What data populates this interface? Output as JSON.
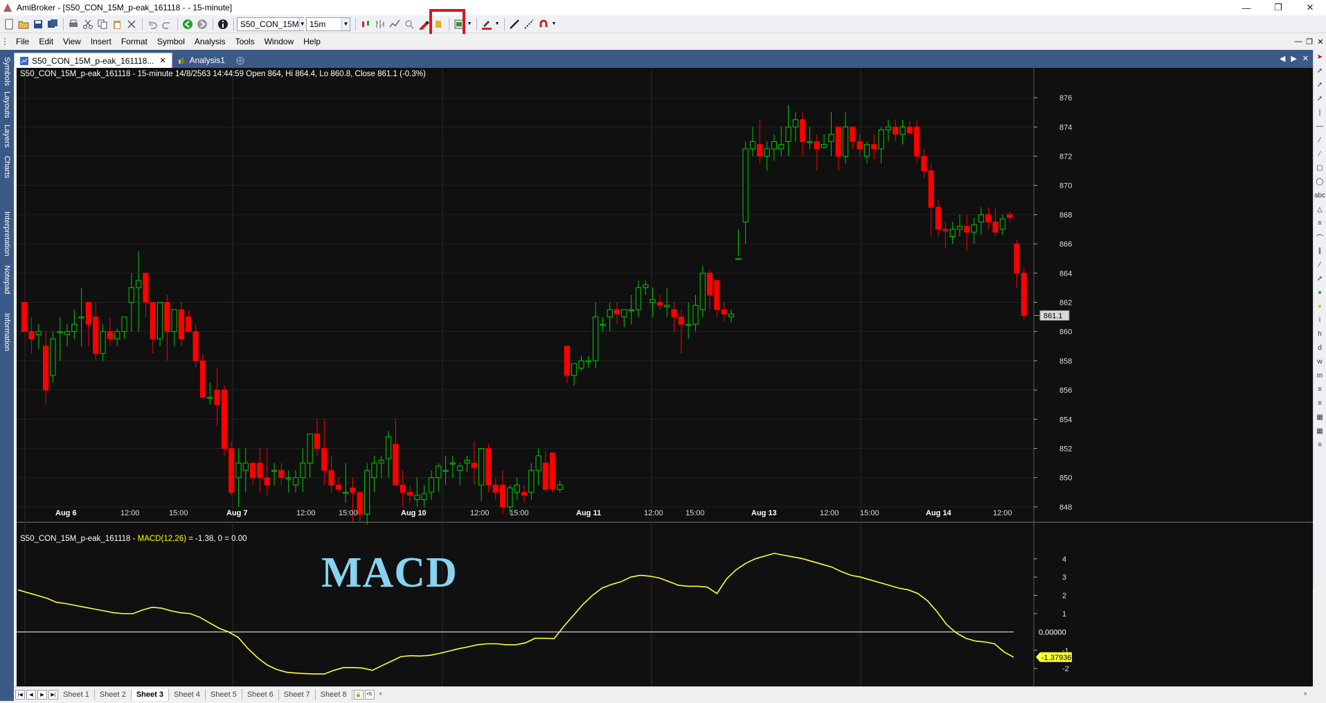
{
  "window": {
    "title": "AmiBroker - [S50_CON_15M_p-eak_161118 -  - 15-minute]"
  },
  "toolbar": {
    "symbol_combo": "S50_CON_15M",
    "interval_combo": "15m"
  },
  "menu": [
    "File",
    "Edit",
    "View",
    "Insert",
    "Format",
    "Symbol",
    "Analysis",
    "Tools",
    "Window",
    "Help"
  ],
  "side_tabs": [
    "Symbols",
    "Layouts",
    "Layers",
    "Charts",
    "Interpretation",
    "Notepad",
    "Information"
  ],
  "doc_tabs": [
    {
      "label": "S50_CON_15M_p-eak_161118..."
    },
    {
      "label": "Analysis1"
    }
  ],
  "price_pane": {
    "title": "S50_CON_15M_p-eak_161118 - 15-minute 14/8/2563 14:44:59 Open 864, Hi 864.4, Lo 860.8, Close 861.1 (-0.3%)",
    "last_price_label": "861.1",
    "y_ticks": [
      "876",
      "874",
      "872",
      "870",
      "868",
      "866",
      "864",
      "862",
      "860",
      "858",
      "856",
      "854",
      "852",
      "850",
      "848"
    ],
    "x_labels": [
      "Aug 6",
      "12:00",
      "15:00",
      "Aug 7",
      "12:00",
      "15:00",
      "Aug 10",
      "12:00",
      "15:00",
      "Aug 11",
      "12:00",
      "15:00",
      "Aug 13",
      "12:00",
      "15:00",
      "Aug 14",
      "12:00"
    ],
    "colors": {
      "up": "#00cc00",
      "down": "#ff0000",
      "background": "#101010"
    }
  },
  "macd_pane": {
    "title_prefix": "S50_CON_15M_p-eak_161118 - ",
    "title_indicator": "MACD(12,26)",
    "title_suffix": " = -1.38, 0 = 0.00",
    "annotation": "MACD",
    "y_ticks": [
      "4",
      "3",
      "2",
      "1",
      "-1",
      "-2"
    ],
    "zero_label": "0.00000",
    "last_label": "-1.37936",
    "colors": {
      "line": "#ffff33",
      "zero": "#ffffff"
    }
  },
  "chart_data": [
    {
      "type": "candlestick",
      "title": "S50_CON_15M_p-eak_161118 - 15-minute",
      "ylim": [
        847,
        877
      ],
      "candles": [
        [
          862,
          862,
          860,
          860
        ],
        [
          860,
          861,
          858.5,
          859.5
        ],
        [
          859.8,
          860.5,
          858.8,
          860
        ],
        [
          859,
          860,
          855,
          856
        ],
        [
          857,
          860,
          856.5,
          859.5
        ],
        [
          860,
          861,
          858,
          860
        ],
        [
          859.8,
          860.5,
          859,
          860
        ],
        [
          860,
          861.5,
          859.5,
          860.5
        ],
        [
          861,
          863,
          859,
          861
        ],
        [
          862,
          862,
          859,
          860.5
        ],
        [
          861,
          862,
          858,
          858.5
        ],
        [
          858.5,
          860.5,
          858,
          860
        ],
        [
          860,
          861,
          859,
          859.5
        ],
        [
          859.5,
          860.2,
          859,
          860
        ],
        [
          860,
          861,
          859.5,
          861
        ],
        [
          862,
          864,
          860,
          863
        ],
        [
          863,
          865.5,
          860,
          863.5
        ],
        [
          864,
          864,
          861,
          862
        ],
        [
          862,
          862,
          858.5,
          859.5
        ],
        [
          859.5,
          862,
          859,
          862
        ],
        [
          862,
          862.5,
          858,
          860
        ],
        [
          860,
          861.5,
          859,
          861.5
        ],
        [
          861.5,
          862,
          859,
          859.5
        ],
        [
          861,
          861.5,
          860,
          860
        ],
        [
          860,
          860.5,
          857.5,
          858
        ],
        [
          858,
          858.5,
          855.5,
          855.5
        ],
        [
          855.5,
          856.5,
          855,
          855.5
        ],
        [
          856,
          857.5,
          853.5,
          855
        ],
        [
          856,
          856.3,
          851.5,
          852
        ],
        [
          852,
          852.5,
          848.8,
          849
        ],
        [
          850,
          852,
          848,
          851
        ],
        [
          850.5,
          852,
          849,
          851
        ],
        [
          851,
          851,
          849.5,
          850
        ],
        [
          851,
          852,
          849,
          850
        ],
        [
          850,
          852,
          848.8,
          849.5
        ],
        [
          850.5,
          851,
          849.5,
          850.5
        ],
        [
          850.5,
          851,
          849.5,
          850
        ],
        [
          850,
          850.5,
          849,
          850
        ],
        [
          849.5,
          850.5,
          849,
          850
        ],
        [
          850,
          852,
          849,
          851
        ],
        [
          851,
          853,
          850,
          853
        ],
        [
          853,
          854,
          851.5,
          852
        ],
        [
          852,
          854,
          849.5,
          850.5
        ],
        [
          850.5,
          851.5,
          849,
          849.5
        ],
        [
          849.5,
          850,
          849,
          849.2
        ],
        [
          849,
          851,
          848.3,
          849
        ],
        [
          849.3,
          850,
          847,
          849
        ],
        [
          849,
          849,
          847,
          847.5
        ],
        [
          847.5,
          851,
          846.8,
          850.5
        ],
        [
          850,
          851.5,
          849,
          851
        ],
        [
          851,
          851.5,
          850,
          851.2
        ],
        [
          851.3,
          853.2,
          850,
          852.8
        ],
        [
          852.3,
          854,
          849.5,
          849.5
        ],
        [
          849.5,
          850.5,
          848,
          849
        ],
        [
          849,
          849.5,
          848.3,
          848.8
        ],
        [
          848.5,
          850,
          848,
          848.8
        ],
        [
          848.5,
          849.5,
          848,
          848.9
        ],
        [
          849,
          850.5,
          848.5,
          850
        ],
        [
          850,
          851,
          849,
          850.8
        ],
        [
          850.5,
          851.5,
          849.5,
          850.5
        ],
        [
          851,
          851.5,
          850,
          851
        ],
        [
          850.5,
          851,
          849.5,
          850.8
        ],
        [
          851,
          851.5,
          850.4,
          851.2
        ],
        [
          851,
          852.5,
          849.5,
          850.7
        ],
        [
          849.5,
          852,
          848.4,
          852
        ],
        [
          852,
          852.3,
          849,
          849.5
        ],
        [
          849.5,
          850,
          848.5,
          849
        ],
        [
          849.5,
          850.5,
          847.5,
          848
        ],
        [
          848,
          849.5,
          847.5,
          849.3
        ],
        [
          849,
          850,
          848.5,
          849.5
        ],
        [
          849,
          849.5,
          848.3,
          848.8
        ],
        [
          849,
          851,
          848.5,
          850.5
        ],
        [
          850.5,
          852,
          849.5,
          851.5
        ],
        [
          851,
          851.8,
          849,
          849.2
        ],
        [
          851.7,
          851.7,
          849,
          849.2
        ],
        [
          849.2,
          849.8,
          849,
          849.5
        ],
        [
          859,
          859,
          856.5,
          857
        ],
        [
          857,
          857.8,
          856.3,
          857.8
        ],
        [
          857.5,
          858.3,
          857.3,
          858
        ],
        [
          858,
          858.3,
          857.5,
          858
        ],
        [
          858,
          862,
          857.5,
          861
        ],
        [
          860.5,
          861,
          860,
          860.5
        ],
        [
          861,
          862,
          860,
          861.5
        ],
        [
          861.5,
          862,
          860.5,
          861.2
        ],
        [
          861,
          861.5,
          860.3,
          861.5
        ],
        [
          861.5,
          862.5,
          860.5,
          861.5
        ],
        [
          861.5,
          863.5,
          861,
          863
        ],
        [
          863,
          863.5,
          862.5,
          863.2
        ],
        [
          862,
          863,
          861,
          862.2
        ],
        [
          862,
          862.5,
          861.5,
          861.8
        ],
        [
          861.7,
          863,
          861,
          861.8
        ],
        [
          861.5,
          862,
          860,
          861
        ],
        [
          861,
          861.5,
          858.5,
          860.5
        ],
        [
          860.5,
          862,
          859.5,
          860.5
        ],
        [
          860.5,
          862.5,
          860,
          861.8
        ],
        [
          861.5,
          864.5,
          861,
          864
        ],
        [
          864,
          864.2,
          861.5,
          862.5
        ],
        [
          863.5,
          863.5,
          861,
          861.5
        ],
        [
          861.5,
          862,
          860.7,
          861.2
        ],
        [
          861,
          861.5,
          860.6,
          861.2
        ],
        [
          865,
          865.2,
          867,
          865
        ],
        [
          867.5,
          873,
          866,
          872.5
        ],
        [
          872.5,
          874,
          872,
          873
        ],
        [
          872.8,
          874.5,
          871.5,
          872
        ],
        [
          872,
          873,
          871,
          872.5
        ],
        [
          872.5,
          873.5,
          871.7,
          873
        ],
        [
          872.5,
          874,
          872,
          872.8
        ],
        [
          873,
          875.5,
          872,
          874
        ],
        [
          874,
          875,
          873,
          874.5
        ],
        [
          874.5,
          875,
          872,
          873
        ],
        [
          873,
          874,
          872.5,
          873
        ],
        [
          873,
          873.5,
          871,
          872.5
        ],
        [
          872.6,
          873.5,
          872.5,
          872.8
        ],
        [
          873,
          875,
          872,
          873.5
        ],
        [
          874,
          874,
          871,
          872
        ],
        [
          872,
          875,
          871.5,
          874
        ],
        [
          874,
          874,
          872.5,
          873
        ],
        [
          873,
          873.5,
          872,
          872.5
        ],
        [
          872,
          873,
          871.5,
          872.8
        ],
        [
          872.8,
          873.5,
          871.8,
          872.5
        ],
        [
          872.5,
          874,
          871.5,
          873.8
        ],
        [
          873.8,
          874.5,
          873,
          874
        ],
        [
          874,
          874.5,
          873,
          873.5
        ],
        [
          873.5,
          874.5,
          872.8,
          874
        ],
        [
          874,
          874.4,
          873.5,
          873.6
        ],
        [
          874,
          874.5,
          871.5,
          872
        ],
        [
          872,
          872.5,
          870.5,
          871
        ],
        [
          871,
          871.5,
          866.5,
          868.5
        ],
        [
          868.5,
          869,
          866.5,
          867
        ],
        [
          867,
          867.5,
          865.7,
          866.9
        ],
        [
          866.5,
          867.5,
          866,
          867
        ],
        [
          867,
          868,
          866.5,
          867.2
        ],
        [
          867.2,
          868,
          865.5,
          866.8
        ],
        [
          866.8,
          867.8,
          866,
          867.3
        ],
        [
          867.5,
          868.5,
          866.6,
          868
        ],
        [
          868,
          868.5,
          867,
          867.5
        ],
        [
          867.5,
          868.5,
          866.5,
          866.8
        ],
        [
          867,
          868,
          866.6,
          867.7
        ],
        [
          868,
          868.2,
          867.5,
          867.8
        ],
        [
          866,
          866.3,
          863,
          864
        ],
        [
          864,
          864.4,
          860.8,
          861.1
        ]
      ]
    },
    {
      "type": "line",
      "title": "MACD(12,26)",
      "ylim": [
        -2.6,
        4.6
      ],
      "series": [
        {
          "name": "MACD(12,26)",
          "values": [
            2.3,
            2.15,
            2,
            1.85,
            1.62,
            1.55,
            1.45,
            1.35,
            1.25,
            1.15,
            1.05,
            1.0,
            1.0,
            1.2,
            1.35,
            1.3,
            1.15,
            1.05,
            1.0,
            0.8,
            0.5,
            0.2,
            0.0,
            -0.3,
            -0.9,
            -1.4,
            -1.8,
            -2.05,
            -2.2,
            -2.25,
            -2.28,
            -2.3,
            -2.3,
            -2.1,
            -1.95,
            -1.95,
            -1.98,
            -2.1,
            -1.85,
            -1.6,
            -1.35,
            -1.3,
            -1.32,
            -1.28,
            -1.18,
            -1.05,
            -0.92,
            -0.82,
            -0.7,
            -0.65,
            -0.65,
            -0.7,
            -0.7,
            -0.6,
            -0.35,
            -0.35,
            -0.36,
            0.3,
            0.9,
            1.5,
            2.0,
            2.4,
            2.6,
            2.75,
            3.0,
            3.1,
            3.05,
            2.95,
            2.75,
            2.55,
            2.5,
            2.5,
            2.45,
            2.1,
            2.9,
            3.4,
            3.75,
            4.0,
            4.15,
            4.3,
            4.2,
            4.1,
            4.0,
            3.85,
            3.7,
            3.55,
            3.3,
            3.1,
            3.0,
            2.85,
            2.7,
            2.55,
            2.4,
            2.3,
            2.1,
            1.7,
            1.1,
            0.4,
            -0.05,
            -0.35,
            -0.5,
            -0.55,
            -0.65,
            -1.1,
            -1.38
          ]
        }
      ]
    }
  ]
}
